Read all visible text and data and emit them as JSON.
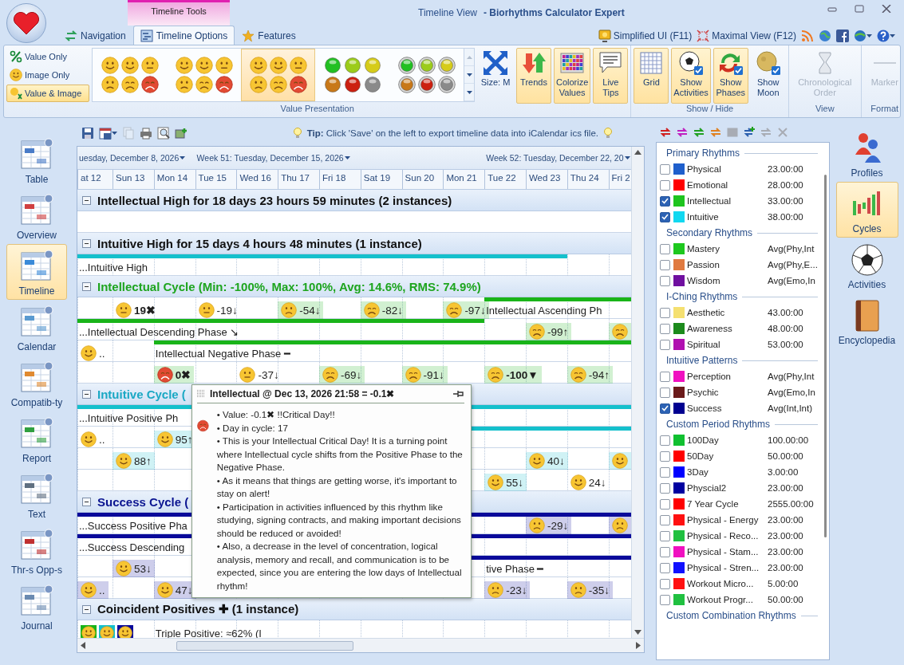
{
  "window": {
    "view": "Timeline View",
    "app": "- Biorhythms Calculator Expert",
    "context_group": "Timeline Tools"
  },
  "tabs": [
    {
      "label": "Navigation",
      "kind": "nav",
      "selected": false
    },
    {
      "label": "Timeline Options",
      "kind": "options",
      "selected": true
    },
    {
      "label": "Features",
      "kind": "star",
      "selected": false
    }
  ],
  "quick": [
    {
      "label": "Simplified UI (F11)",
      "kind": "monitor"
    },
    {
      "label": "Maximal View (F12)",
      "kind": "expand"
    }
  ],
  "presentation": {
    "title": "Value Presentation",
    "modes": [
      {
        "label": "Value Only",
        "kind": "percent",
        "selected": false
      },
      {
        "label": "Image Only",
        "kind": "face",
        "selected": false
      },
      {
        "label": "Value & Image",
        "kind": "both",
        "selected": true
      }
    ],
    "gallery": [
      {
        "kind": "glossy",
        "selected": false
      },
      {
        "kind": "cartoon",
        "selected": false
      },
      {
        "kind": "soft",
        "selected": true
      },
      {
        "kind": "balls",
        "selected": false
      },
      {
        "kind": "rings",
        "selected": false
      }
    ],
    "size": {
      "label": "Size: M"
    },
    "toggles": [
      {
        "label": "Trends",
        "kind": "trends",
        "on": true
      },
      {
        "label": "Colorize Values",
        "kind": "colorize",
        "on": true
      },
      {
        "label": "Live Tips",
        "kind": "tips",
        "on": true
      }
    ]
  },
  "show_hide": {
    "title": "Show / Hide",
    "buttons": [
      {
        "label": "Grid",
        "kind": "grid",
        "on": true
      },
      {
        "label": "Show Activities",
        "kind": "ball",
        "on": true
      },
      {
        "label": "Show Phases",
        "kind": "phases",
        "on": true
      },
      {
        "label": "Show Moon",
        "kind": "moon",
        "on": false
      }
    ]
  },
  "view": {
    "title": "View",
    "buttons": [
      {
        "label": "Chronological Order",
        "kind": "hourglass",
        "disabled": true
      }
    ]
  },
  "format": {
    "title": "Format",
    "buttons": [
      {
        "label": "Marker",
        "kind": "marker",
        "disabled": true
      }
    ]
  },
  "left_nav": [
    {
      "label": "Table",
      "kind": "table",
      "selected": false
    },
    {
      "label": "Overview",
      "kind": "overview",
      "selected": false
    },
    {
      "label": "Timeline",
      "kind": "timeline",
      "selected": true
    },
    {
      "label": "Calendar",
      "kind": "calendar",
      "selected": false
    },
    {
      "label": "Compatib-ty",
      "kind": "compat",
      "selected": false
    },
    {
      "label": "Report",
      "kind": "report",
      "selected": false
    },
    {
      "label": "Text",
      "kind": "text",
      "selected": false
    },
    {
      "label": "Thr-s Opp-s",
      "kind": "opps",
      "selected": false
    },
    {
      "label": "Journal",
      "kind": "journal",
      "selected": false
    }
  ],
  "toolbar": {
    "tools": [
      {
        "kind": "save",
        "disabled": false
      },
      {
        "kind": "save-as",
        "disabled": false
      },
      {
        "kind": "copy",
        "disabled": true
      },
      {
        "kind": "print",
        "disabled": false
      },
      {
        "kind": "preview",
        "disabled": false
      },
      {
        "kind": "export",
        "disabled": false
      }
    ],
    "tip": "**Tip:** Click 'Save' on the left to export timeline data into iCalendar ics file."
  },
  "timeline": {
    "weeks": [
      {
        "kind": "text",
        "text": "uesday, December 8, 2026"
      },
      {
        "kind": "gap"
      },
      {
        "kind": "gap"
      },
      {
        "kind": "text",
        "text": "Week 51: Tuesday, December 15, 2026"
      },
      {
        "kind": "gap"
      },
      {
        "kind": "gap"
      },
      {
        "kind": "gap"
      },
      {
        "kind": "gap"
      },
      {
        "kind": "gap"
      },
      {
        "kind": "gap"
      },
      {
        "kind": "text",
        "text": "Week 52: Tuesday, December 22, 20"
      }
    ],
    "days": [
      "at 12",
      "Sun 13",
      "Mon 14",
      "Tue 15",
      "Wed 16",
      "Thu 17",
      "Fri 18",
      "Sat 19",
      "Sun 20",
      "Mon 21",
      "Tue 22",
      "Wed 23",
      "Thu 24",
      "Fri 2"
    ],
    "rows": [
      {
        "kind": "header",
        "title": "Intellectual High for 18 days 23 hours 59 minutes (2 instances)",
        "color": "#111111",
        "expanded": true
      },
      {
        "kind": "lane"
      },
      {
        "kind": "header",
        "title": "Intuitive High for 15 days 4 hours 48 minutes (1 instance)",
        "color": "#111111",
        "expanded": true
      },
      {
        "kind": "lane",
        "color": "#14c0cc",
        "cells": [
          {
            "kind": "label",
            "text": "...Intuitive High",
            "bar": true
          },
          {
            "kind": "gap",
            "bar": true
          },
          {
            "kind": "gap",
            "bar": true
          },
          {
            "kind": "gap",
            "bar": true
          },
          {
            "kind": "gap",
            "bar": true
          },
          {
            "kind": "gap",
            "bar": true
          },
          {
            "kind": "gap",
            "bar": true
          },
          {
            "kind": "gap",
            "bar": true
          },
          {
            "kind": "gap",
            "bar": true
          },
          {
            "kind": "gap",
            "bar": true
          },
          {
            "kind": "gap",
            "bar": true
          },
          {
            "kind": "gap",
            "bar": true
          }
        ]
      },
      {
        "kind": "header",
        "title": "Intellectual Cycle (Min: -100%, Max: 100%, Avg: 14.6%, RMS: 74.9%)",
        "color": "#1ea51e",
        "expanded": true
      },
      {
        "kind": "lane",
        "color": "#19b419",
        "cells": [
          {
            "kind": "gap"
          },
          {
            "kind": "neutral",
            "value": "19✖",
            "strong": true
          },
          {
            "kind": "gap"
          },
          {
            "kind": "neutral",
            "value": "-19↓"
          },
          {
            "kind": "gap"
          },
          {
            "kind": "sad",
            "value": "-54↓",
            "shade": true
          },
          {
            "kind": "gap"
          },
          {
            "kind": "upset",
            "value": "-82↓",
            "shade": true
          },
          {
            "kind": "gap"
          },
          {
            "kind": "upset",
            "value": "-97↓",
            "shade": true
          },
          {
            "kind": "label",
            "text": "Intellectual Ascending Ph",
            "bar": true
          },
          {
            "kind": "gap",
            "bar": true
          },
          {
            "kind": "gap",
            "bar": true
          },
          {
            "kind": "gap",
            "bar": true
          }
        ]
      },
      {
        "kind": "lane",
        "color": "#19b419",
        "cells": [
          {
            "kind": "label",
            "text": "...Intellectual Descending Phase ↘",
            "bar": true
          },
          {
            "kind": "gap",
            "bar": true
          },
          {
            "kind": "gap",
            "bar": true
          },
          {
            "kind": "gap",
            "bar": true
          },
          {
            "kind": "gap",
            "bar": true
          },
          {
            "kind": "gap",
            "bar": true
          },
          {
            "kind": "gap",
            "bar": true
          },
          {
            "kind": "gap",
            "bar": true
          },
          {
            "kind": "gap",
            "bar": true
          },
          {
            "kind": "gap",
            "bar": true
          },
          {
            "kind": "gap"
          },
          {
            "kind": "upset",
            "value": "-99↑",
            "shade": true
          },
          {
            "kind": "gap"
          },
          {
            "kind": "upset",
            "shade": true
          }
        ]
      },
      {
        "kind": "lane",
        "color": "#19b419",
        "cells": [
          {
            "kind": "smile",
            "value": ".."
          },
          {
            "kind": "gap"
          },
          {
            "kind": "label",
            "text": "Intellectual Negative Phase ━",
            "bar": true
          },
          {
            "kind": "gap",
            "bar": true
          },
          {
            "kind": "gap",
            "bar": true
          },
          {
            "kind": "gap",
            "bar": true
          },
          {
            "kind": "gap",
            "bar": true
          },
          {
            "kind": "gap",
            "bar": true
          },
          {
            "kind": "gap",
            "bar": true
          },
          {
            "kind": "gap",
            "bar": true
          },
          {
            "kind": "gap",
            "bar": true
          },
          {
            "kind": "gap",
            "bar": true
          },
          {
            "kind": "gap",
            "bar": true
          },
          {
            "kind": "gap",
            "bar": true
          }
        ]
      },
      {
        "kind": "lane",
        "cells": [
          {
            "kind": "gap"
          },
          {
            "kind": "gap"
          },
          {
            "kind": "critical",
            "value": "0✖",
            "strong": true,
            "shade": true
          },
          {
            "kind": "gap"
          },
          {
            "kind": "neutral",
            "value": "-37↓"
          },
          {
            "kind": "gap"
          },
          {
            "kind": "upset",
            "value": "-69↓",
            "shade": true
          },
          {
            "kind": "gap"
          },
          {
            "kind": "upset",
            "value": "-91↓",
            "shade": true
          },
          {
            "kind": "gap"
          },
          {
            "kind": "upset",
            "value": "-100▼",
            "strong": true,
            "shade": true
          },
          {
            "kind": "gap"
          },
          {
            "kind": "upset",
            "value": "-94↑",
            "shade": true
          }
        ]
      },
      {
        "kind": "header",
        "title": "Intuitive Cycle (",
        "color": "#1aa8c4",
        "expanded": true
      },
      {
        "kind": "lane",
        "color": "#14c0cc",
        "cells": [
          {
            "kind": "label",
            "text": "...Intuitive Positive Ph",
            "bar": true
          },
          {
            "kind": "gap",
            "bar": true
          },
          {
            "kind": "gap",
            "bar": true
          },
          {
            "kind": "gap",
            "bar": true
          },
          {
            "kind": "gap",
            "bar": true
          },
          {
            "kind": "gap",
            "bar": true
          },
          {
            "kind": "gap",
            "bar": true
          },
          {
            "kind": "gap",
            "bar": true
          },
          {
            "kind": "gap",
            "bar": true
          },
          {
            "kind": "gap",
            "bar": true
          },
          {
            "kind": "gap",
            "bar": true
          },
          {
            "kind": "gap",
            "bar": true
          },
          {
            "kind": "gap",
            "bar": true
          },
          {
            "kind": "gap",
            "bar": true
          }
        ]
      },
      {
        "kind": "lane",
        "color": "#14c0cc",
        "cells": [
          {
            "kind": "smile",
            "value": ".."
          },
          {
            "kind": "gap"
          },
          {
            "kind": "smile",
            "value": "95↑",
            "shade": true
          },
          {
            "kind": "gap"
          },
          {
            "kind": "gap"
          },
          {
            "kind": "gap"
          },
          {
            "kind": "gap",
            "bar": true
          },
          {
            "kind": "gap",
            "bar": true
          },
          {
            "kind": "gap",
            "bar": true
          },
          {
            "kind": "gap",
            "bar": true
          },
          {
            "kind": "gap",
            "bar": true
          },
          {
            "kind": "gap",
            "bar": true
          },
          {
            "kind": "gap",
            "bar": true
          },
          {
            "kind": "gap",
            "bar": true
          }
        ]
      },
      {
        "kind": "lane",
        "cells": [
          {
            "kind": "gap"
          },
          {
            "kind": "smile",
            "value": "88↑",
            "shade": true
          },
          {
            "kind": "gap"
          },
          {
            "kind": "gap"
          },
          {
            "kind": "gap"
          },
          {
            "kind": "gap"
          },
          {
            "kind": "gap"
          },
          {
            "kind": "gap"
          },
          {
            "kind": "gap"
          },
          {
            "kind": "gap"
          },
          {
            "kind": "gap"
          },
          {
            "kind": "smile",
            "value": "40↓",
            "shade": true
          },
          {
            "kind": "gap"
          },
          {
            "kind": "smile",
            "shade": true
          }
        ]
      },
      {
        "kind": "lane",
        "cells": [
          {
            "kind": "gap"
          },
          {
            "kind": "gap"
          },
          {
            "kind": "gap"
          },
          {
            "kind": "gap"
          },
          {
            "kind": "gap"
          },
          {
            "kind": "gap"
          },
          {
            "kind": "gap"
          },
          {
            "kind": "gap"
          },
          {
            "kind": "gap"
          },
          {
            "kind": "gap"
          },
          {
            "kind": "smile",
            "value": "55↓",
            "shade": true
          },
          {
            "kind": "gap"
          },
          {
            "kind": "smile",
            "value": "24↓"
          }
        ]
      },
      {
        "kind": "header",
        "title": "Success Cycle (",
        "color": "#0a1490",
        "expanded": true
      },
      {
        "kind": "lane",
        "color": "#0a0a9a",
        "cells": [
          {
            "kind": "label",
            "text": "...Success Positive Pha",
            "bar": true
          },
          {
            "kind": "gap",
            "bar": true
          },
          {
            "kind": "gap",
            "bar": true
          },
          {
            "kind": "gap",
            "bar": true
          },
          {
            "kind": "gap",
            "bar": true
          },
          {
            "kind": "gap",
            "bar": true
          },
          {
            "kind": "gap",
            "bar": true
          },
          {
            "kind": "gap",
            "bar": true
          },
          {
            "kind": "gap",
            "bar": true
          },
          {
            "kind": "gap",
            "bar": true
          },
          {
            "kind": "gap",
            "bar": true
          },
          {
            "kind": "sad",
            "value": "-29↓",
            "shade": true,
            "bar": true
          },
          {
            "kind": "gap",
            "bar": true
          },
          {
            "kind": "sad",
            "shade": true,
            "bar": true
          }
        ]
      },
      {
        "kind": "lane",
        "color": "#0a0a9a",
        "cells": [
          {
            "kind": "label",
            "text": "...Success Descending",
            "bar": true
          },
          {
            "kind": "gap",
            "bar": true
          },
          {
            "kind": "gap",
            "bar": true
          },
          {
            "kind": "gap",
            "bar": true
          },
          {
            "kind": "gap",
            "bar": true
          },
          {
            "kind": "gap",
            "bar": true
          },
          {
            "kind": "gap",
            "bar": true
          },
          {
            "kind": "gap",
            "bar": true
          },
          {
            "kind": "gap",
            "bar": true
          },
          {
            "kind": "gap",
            "bar": true
          },
          {
            "kind": "gap",
            "bar": true
          },
          {
            "kind": "gap",
            "bar": true
          },
          {
            "kind": "gap",
            "bar": true
          },
          {
            "kind": "gap",
            "bar": true
          }
        ]
      },
      {
        "kind": "lane",
        "color": "#0a0a9a",
        "cells": [
          {
            "kind": "gap"
          },
          {
            "kind": "smile",
            "value": "53↓",
            "shade": true
          },
          {
            "kind": "gap"
          },
          {
            "kind": "gap"
          },
          {
            "kind": "gap"
          },
          {
            "kind": "gap"
          },
          {
            "kind": "gap"
          },
          {
            "kind": "gap"
          },
          {
            "kind": "gap"
          },
          {
            "kind": "gap",
            "bar": true
          },
          {
            "kind": "label",
            "text": "tive Phase ━",
            "bar": true
          },
          {
            "kind": "gap",
            "bar": true
          },
          {
            "kind": "gap",
            "bar": true
          },
          {
            "kind": "gap",
            "bar": true
          }
        ]
      },
      {
        "kind": "lane",
        "cells": [
          {
            "kind": "smile",
            "value": "..",
            "shade": true
          },
          {
            "kind": "gap"
          },
          {
            "kind": "smile",
            "value": "47↓",
            "shade": true
          },
          {
            "kind": "gap"
          },
          {
            "kind": "gap"
          },
          {
            "kind": "gap"
          },
          {
            "kind": "gap"
          },
          {
            "kind": "gap"
          },
          {
            "kind": "gap"
          },
          {
            "kind": "gap"
          },
          {
            "kind": "sad",
            "value": "-23↓",
            "shade": true
          },
          {
            "kind": "gap"
          },
          {
            "kind": "sad",
            "value": "-35↓",
            "shade": true
          }
        ]
      },
      {
        "kind": "header",
        "title": "Coincident Positives ✚ (1 instance)",
        "color": "#111111",
        "expanded": true
      },
      {
        "kind": "lane",
        "cells": [
          {
            "kind": "faces",
            "faces": [
              {
                "color": "#19b419"
              },
              {
                "color": "#14c0cc"
              },
              {
                "color": "#0a0a9a"
              }
            ]
          },
          {
            "kind": "gap"
          },
          {
            "kind": "label",
            "text": "Triple Positive: ≈62% (I"
          }
        ]
      }
    ],
    "tooltip": {
      "title": "Intellectual @ Dec 13, 2026 21:58 = -0.1✖",
      "icon": {
        "kind": "critical"
      },
      "lines": [
        "• Value: -0.1✖  !!Critical Day!!",
        "• Day in cycle: 17",
        "• This is your Intellectual Critical Day! It is a turning point where Intellectual cycle shifts from the Positive Phase to the Negative Phase.",
        "• As it means that things are getting worse, it's important to stay on alert!",
        "• Participation in activities influenced by this rhythm like studying, signing contracts, and making important decisions should be reduced or avoided!",
        "• Also, a decrease in the level of concentration, logical analysis, memory and recall, and communication is to be expected, since you are entering the low days of Intellectual rhythm!"
      ]
    }
  },
  "rhythm_tools": [
    {
      "kind": "swap",
      "color": "#d02020",
      "disabled": false
    },
    {
      "kind": "swap",
      "color": "#c020c0",
      "disabled": false
    },
    {
      "kind": "swap",
      "color": "#20a020",
      "disabled": false
    },
    {
      "kind": "swap",
      "color": "#e08020",
      "disabled": false
    },
    {
      "kind": "table",
      "disabled": true
    },
    {
      "kind": "add",
      "color": "#20a020",
      "disabled": false
    },
    {
      "kind": "swap",
      "disabled": true
    },
    {
      "kind": "clear",
      "disabled": true
    }
  ],
  "rhythms": [
    {
      "title": "Primary Rhythms",
      "items": [
        {
          "name": "Physical",
          "color": "#1f5fcc",
          "period": "23.00:00",
          "checked": false
        },
        {
          "name": "Emotional",
          "color": "#ff0000",
          "period": "28.00:00",
          "checked": false
        },
        {
          "name": "Intellectual",
          "color": "#1ec41e",
          "period": "33.00:00",
          "checked": true
        },
        {
          "name": "Intuitive",
          "color": "#11d8f0",
          "period": "38.00:00",
          "checked": true
        }
      ]
    },
    {
      "title": "Secondary Rhythms",
      "items": [
        {
          "name": "Mastery",
          "color": "#1ec81e",
          "period": "Avg(Phy,Int",
          "checked": false
        },
        {
          "name": "Passion",
          "color": "#e07a40",
          "period": "Avg(Phy,E...",
          "checked": false
        },
        {
          "name": "Wisdom",
          "color": "#7010a0",
          "period": "Avg(Emo,In",
          "checked": false
        }
      ]
    },
    {
      "title": "I-Ching Rhythms",
      "items": [
        {
          "name": "Aesthetic",
          "color": "#f5e070",
          "period": "43.00:00",
          "checked": false
        },
        {
          "name": "Awareness",
          "color": "#1c8a1c",
          "period": "48.00:00",
          "checked": false
        },
        {
          "name": "Spiritual",
          "color": "#b010b0",
          "period": "53.00:00",
          "checked": false
        }
      ]
    },
    {
      "title": "Intuitive Patterns",
      "items": [
        {
          "name": "Perception",
          "color": "#f010c0",
          "period": "Avg(Phy,Int",
          "checked": false
        },
        {
          "name": "Psychic",
          "color": "#6a1a1a",
          "period": "Avg(Emo,In",
          "checked": false
        },
        {
          "name": "Success",
          "color": "#000090",
          "period": "Avg(Int,Int)",
          "checked": true
        }
      ]
    },
    {
      "title": "Custom Period Rhythms",
      "items": [
        {
          "name": "100Day",
          "color": "#10c030",
          "period": "100.00:00",
          "checked": false
        },
        {
          "name": "50Day",
          "color": "#ff0000",
          "period": "50.00:00",
          "checked": false
        },
        {
          "name": "3Day",
          "color": "#0000ff",
          "period": "3.00:00",
          "checked": false
        },
        {
          "name": "Physcial2",
          "color": "#0000a0",
          "period": "23.00:00",
          "checked": false
        },
        {
          "name": "7 Year Cycle",
          "color": "#ff0000",
          "period": "2555.00:00",
          "checked": false
        },
        {
          "name": "Physical - Energy",
          "color": "#ff1010",
          "period": "23.00:00",
          "checked": false
        },
        {
          "name": "Physical - Reco...",
          "color": "#20c040",
          "period": "23.00:00",
          "checked": false
        },
        {
          "name": "Physical - Stam...",
          "color": "#f010c0",
          "period": "23.00:00",
          "checked": false
        },
        {
          "name": "Physical - Stren...",
          "color": "#1010ff",
          "period": "23.00:00",
          "checked": false
        },
        {
          "name": "Workout Micro...",
          "color": "#ff1010",
          "period": "5.00:00",
          "checked": false
        },
        {
          "name": "Workout Progr...",
          "color": "#20c040",
          "period": "50.00:00",
          "checked": false
        }
      ]
    },
    {
      "title": "Custom Combination Rhythms"
    }
  ],
  "right_nav": [
    {
      "label": "Profiles",
      "kind": "profiles",
      "selected": false
    },
    {
      "label": "Cycles",
      "kind": "cycles",
      "selected": true
    },
    {
      "label": "Activities",
      "kind": "activities",
      "selected": false
    },
    {
      "label": "Encyclopedia",
      "kind": "encyclopedia",
      "selected": false
    }
  ]
}
